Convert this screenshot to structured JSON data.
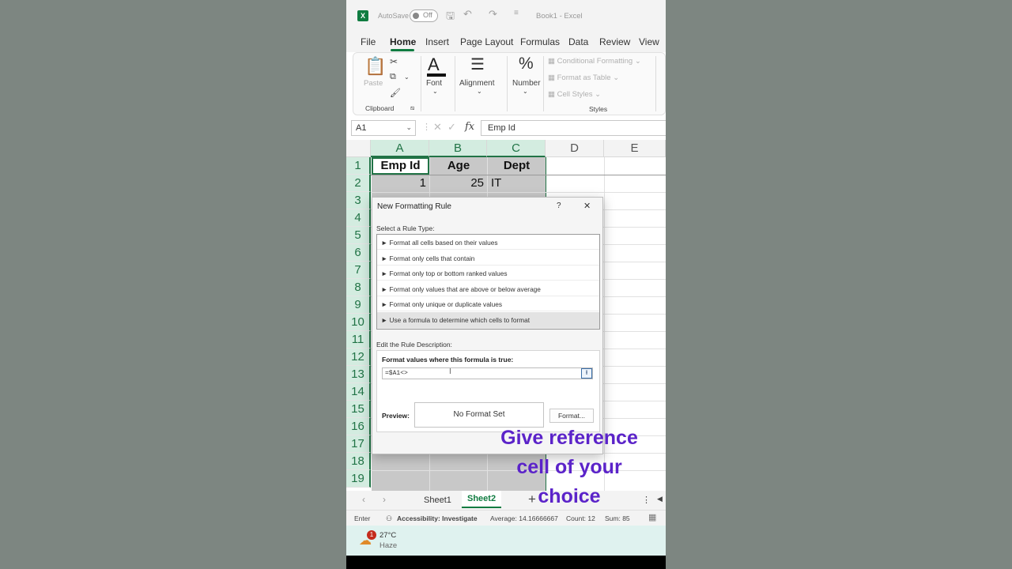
{
  "titlebar": {
    "logo": "X",
    "autosave_label": "AutoSave",
    "toggle_label": "Off",
    "title": "Book1  -  Excel"
  },
  "menu_tabs": [
    "File",
    "Home",
    "Insert",
    "Page Layout",
    "Formulas",
    "Data",
    "Review",
    "View"
  ],
  "ribbon": {
    "clipboard": {
      "paste": "Paste",
      "group": "Clipboard"
    },
    "font": {
      "glyph": "A",
      "label": "Font"
    },
    "alignment": {
      "label": "Alignment"
    },
    "number": {
      "glyph": "%",
      "label": "Number"
    },
    "styles": {
      "conditional_formatting": "Conditional Formatting",
      "format_as_table": "Format as Table",
      "cell_styles": "Cell Styles",
      "group": "Styles"
    }
  },
  "formula_bar": {
    "name_box": "A1",
    "fx": "fx",
    "content": "Emp Id"
  },
  "grid": {
    "columns": [
      "A",
      "B",
      "C",
      "D",
      "E"
    ],
    "rows": [
      "1",
      "2",
      "3",
      "4",
      "5",
      "6",
      "7",
      "8",
      "9",
      "10",
      "11",
      "12",
      "13",
      "14",
      "15",
      "16",
      "17",
      "18",
      "19"
    ],
    "cells": {
      "a1": "Emp Id",
      "b1": "Age",
      "c1": "Dept",
      "a2": "1",
      "b2": "25",
      "c2": "IT"
    }
  },
  "dialog": {
    "title": "New Formatting Rule",
    "help": "?",
    "close": "✕",
    "select_label": "Select a Rule Type:",
    "rules": [
      "► Format all cells based on their values",
      "► Format only cells that contain",
      "► Format only top or bottom ranked values",
      "► Format only values that are above or below average",
      "► Format only unique or duplicate values",
      "► Use a formula to determine which cells to format"
    ],
    "edit_label": "Edit the Rule Description:",
    "formula_label": "Format values where this formula is true:",
    "formula_value": "=$A1<>",
    "preview_label": "Preview:",
    "preview_text": "No Format Set",
    "format_button": "Format..."
  },
  "sheets": {
    "tabs": [
      "Sheet1",
      "Sheet2"
    ],
    "active": "Sheet2",
    "add": "+"
  },
  "status": {
    "mode": "Enter",
    "accessibility": "Accessibility: Investigate",
    "average": "Average: 14.16666667",
    "count": "Count: 12",
    "sum": "Sum: 85"
  },
  "taskbar": {
    "badge": "1",
    "temp": "27°C",
    "condition": "Haze"
  },
  "overlay": {
    "line1": "Give reference",
    "line2": "cell of your",
    "line3": "choice"
  },
  "colors": {
    "excel_green": "#107c41",
    "overlay_purple": "#5b23c9",
    "selection_gray": "#c8c8c8"
  }
}
